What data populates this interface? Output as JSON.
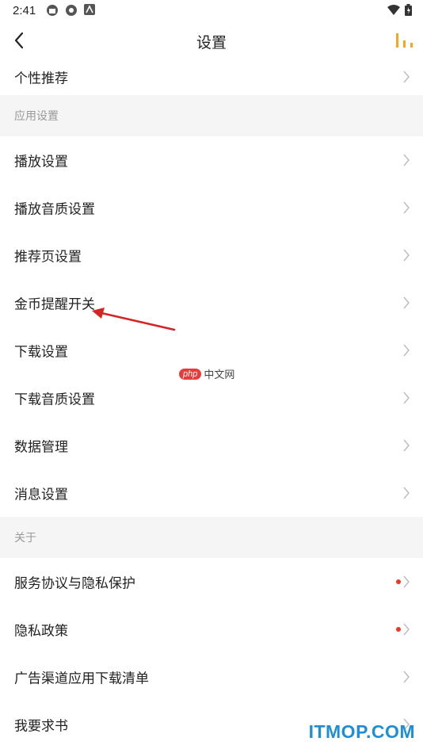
{
  "status_bar": {
    "time": "2:41"
  },
  "header": {
    "title": "设置"
  },
  "list": {
    "top_item": {
      "label": "个性推荐"
    },
    "sections": [
      {
        "title": "应用设置",
        "items": [
          {
            "label": "播放设置"
          },
          {
            "label": "播放音质设置"
          },
          {
            "label": "推荐页设置"
          },
          {
            "label": "金币提醒开关"
          },
          {
            "label": "下载设置"
          },
          {
            "label": "下载音质设置"
          },
          {
            "label": "数据管理"
          },
          {
            "label": "消息设置"
          }
        ]
      },
      {
        "title": "关于",
        "items": [
          {
            "label": "服务协议与隐私保护",
            "has_red_dot": true
          },
          {
            "label": "隐私政策",
            "has_red_dot": true
          },
          {
            "label": "广告渠道应用下载清单"
          },
          {
            "label": "我要求书"
          }
        ]
      }
    ]
  },
  "watermarks": {
    "center_php": "php",
    "center_cn": "中文网",
    "bottom": "ITMOP.COM"
  },
  "colors": {
    "accent": "#f5a623",
    "red_dot": "#e8372c",
    "annotation_arrow": "#d42424",
    "section_bg": "#f5f5f5"
  },
  "icons": {
    "back": "chevron-left-icon",
    "chart": "bar-chart-icon",
    "row_arrow": "chevron-right-icon"
  }
}
